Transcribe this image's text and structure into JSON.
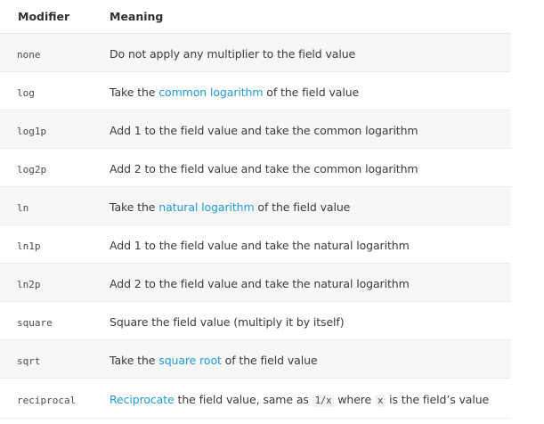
{
  "colors": {
    "link": "#1f9ad6",
    "stripe": "#f7f7f7",
    "text": "#333333"
  },
  "table": {
    "headers": {
      "modifier": "Modifier",
      "meaning": "Meaning"
    },
    "rows": [
      {
        "modifier": "none",
        "meaning": [
          "Do not apply any multiplier to the field value"
        ]
      },
      {
        "modifier": "log",
        "meaning": [
          "Take the ",
          "common logarithm",
          " of the field value"
        ]
      },
      {
        "modifier": "log1p",
        "meaning": [
          "Add 1 to the field value and take the common logarithm"
        ]
      },
      {
        "modifier": "log2p",
        "meaning": [
          "Add 2 to the field value and take the common logarithm"
        ]
      },
      {
        "modifier": "ln",
        "meaning": [
          "Take the ",
          "natural logarithm",
          " of the field value"
        ]
      },
      {
        "modifier": "ln1p",
        "meaning": [
          "Add 1 to the field value and take the natural logarithm"
        ]
      },
      {
        "modifier": "ln2p",
        "meaning": [
          "Add 2 to the field value and take the natural logarithm"
        ]
      },
      {
        "modifier": "square",
        "meaning": [
          "Square the field value (multiply it by itself)"
        ]
      },
      {
        "modifier": "sqrt",
        "meaning": [
          "Take the ",
          "square root",
          " of the field value"
        ]
      },
      {
        "modifier": "reciprocal",
        "meaning": [
          "Reciprocate",
          " the field value, same as ",
          "1/x",
          " where ",
          "x",
          " is the field’s value"
        ]
      }
    ]
  }
}
